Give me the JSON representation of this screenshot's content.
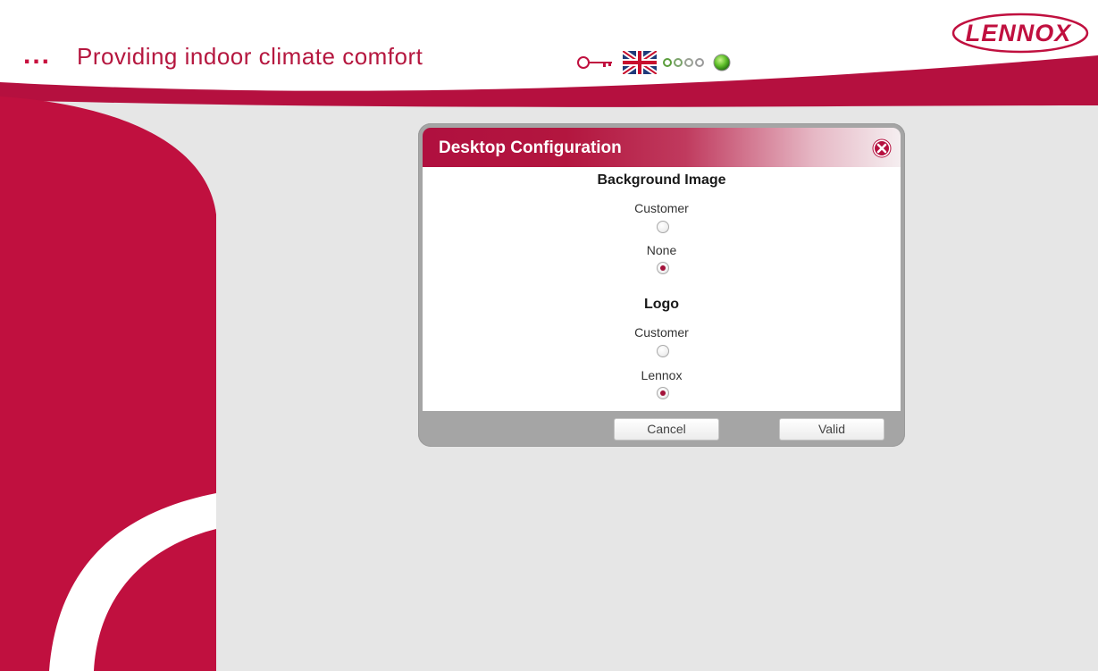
{
  "header": {
    "dots": "...",
    "tagline": "Providing indoor climate comfort",
    "logo_text": "LENNOX",
    "icons": [
      "key-icon",
      "uk-flag-icon",
      "progress-dots-icon",
      "status-led-icon"
    ]
  },
  "colors": {
    "brand_red": "#b5103f",
    "background_gray": "#e6e6e6",
    "dialog_frame": "#a5a5a5",
    "status_green": "#5fbf2a"
  },
  "dialog": {
    "title": "Desktop Configuration",
    "close_icon": "close-circle-icon",
    "background_image": {
      "heading": "Background Image",
      "options": [
        {
          "label": "Customer",
          "checked": false
        },
        {
          "label": "None",
          "checked": true
        }
      ]
    },
    "logo": {
      "heading": "Logo",
      "options": [
        {
          "label": "Customer",
          "checked": false
        },
        {
          "label": "Lennox",
          "checked": true
        }
      ]
    },
    "buttons": {
      "cancel": "Cancel",
      "valid": "Valid"
    }
  }
}
